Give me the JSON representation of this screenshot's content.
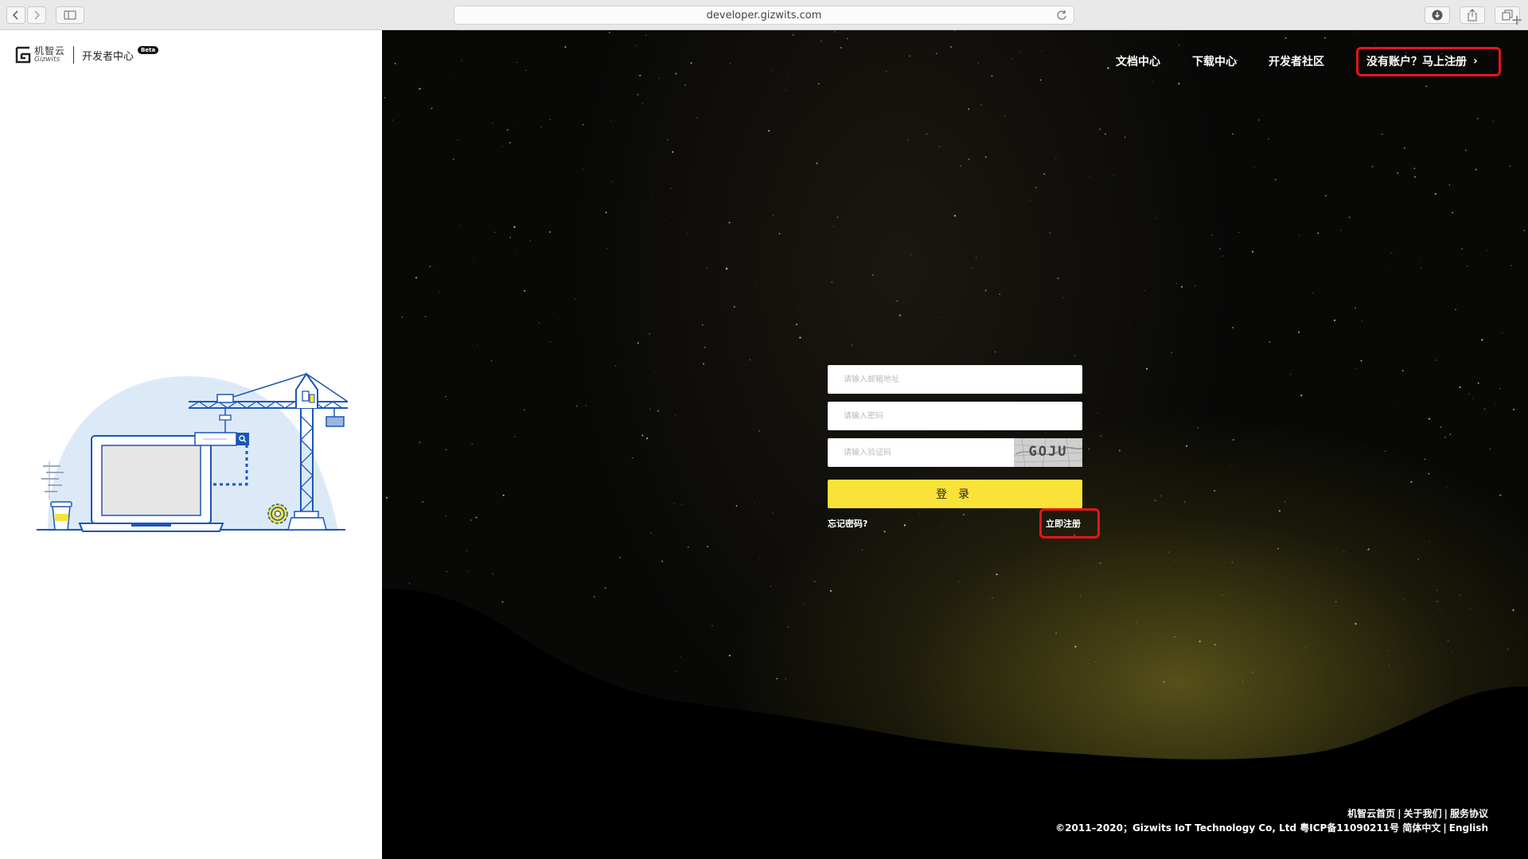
{
  "browser": {
    "url": "developer.gizwits.com"
  },
  "brand": {
    "logo_cn": "机智云",
    "logo_en": "Gizwits",
    "dev_center": "开发者中心",
    "badge": "Beta"
  },
  "nav": {
    "docs": "文档中心",
    "downloads": "下载中心",
    "community": "开发者社区",
    "register_cta": "没有账户？马上注册",
    "register_chevron": "›"
  },
  "form": {
    "email_placeholder": "请输入邮箱地址",
    "password_placeholder": "请输入密码",
    "captcha_placeholder": "请输入验证码",
    "captcha_text": "GOJU",
    "login_label": "登录",
    "forgot_password": "忘记密码?",
    "register_now": "立即注册"
  },
  "footer": {
    "link_home": "机智云首页",
    "link_about": "关于我们",
    "link_terms": "服务协议",
    "copyright": "©2011–2020；Gizwits IoT Technology Co, Ltd 粤ICP备11090211号",
    "lang_cn": "简体中文",
    "lang_en": "English",
    "separator": "|"
  },
  "colors": {
    "login_button": "#fae338",
    "highlight_box": "#e8141b",
    "illustration_blue": "#1a56b8",
    "illustration_bg": "#dceaf8"
  }
}
